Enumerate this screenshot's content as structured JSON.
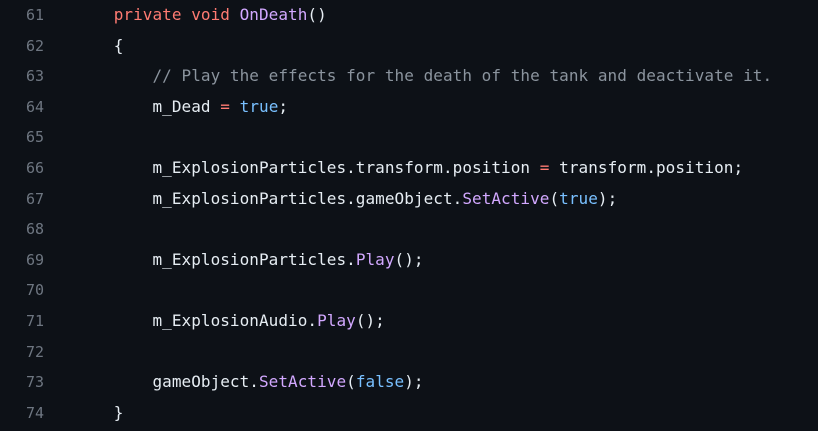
{
  "theme": {
    "background": "#0d1117",
    "line_number_color": "#6e7681",
    "text_color": "#e6edf3",
    "keyword_color": "#ff7b72",
    "function_color": "#d2a8ff",
    "constant_color": "#79c0ff",
    "comment_color": "#8b949e"
  },
  "lines": [
    {
      "number": "61",
      "indent": "    ",
      "tokens": [
        {
          "t": "private",
          "k": "keyword"
        },
        {
          "t": " ",
          "k": "plain"
        },
        {
          "t": "void",
          "k": "keyword"
        },
        {
          "t": " ",
          "k": "plain"
        },
        {
          "t": "OnDeath",
          "k": "func"
        },
        {
          "t": "()",
          "k": "plain"
        }
      ]
    },
    {
      "number": "62",
      "indent": "    ",
      "tokens": [
        {
          "t": "{",
          "k": "plain"
        }
      ]
    },
    {
      "number": "63",
      "indent": "        ",
      "tokens": [
        {
          "t": "// Play the effects for the death of the tank and deactivate it.",
          "k": "comment"
        }
      ]
    },
    {
      "number": "64",
      "indent": "        ",
      "tokens": [
        {
          "t": "m_Dead",
          "k": "plain"
        },
        {
          "t": " ",
          "k": "plain"
        },
        {
          "t": "=",
          "k": "op"
        },
        {
          "t": " ",
          "k": "plain"
        },
        {
          "t": "true",
          "k": "const"
        },
        {
          "t": ";",
          "k": "plain"
        }
      ]
    },
    {
      "number": "65",
      "indent": "",
      "tokens": []
    },
    {
      "number": "66",
      "indent": "        ",
      "tokens": [
        {
          "t": "m_ExplosionParticles.transform.position",
          "k": "plain"
        },
        {
          "t": " ",
          "k": "plain"
        },
        {
          "t": "=",
          "k": "op"
        },
        {
          "t": " ",
          "k": "plain"
        },
        {
          "t": "transform.position;",
          "k": "plain"
        }
      ]
    },
    {
      "number": "67",
      "indent": "        ",
      "tokens": [
        {
          "t": "m_ExplosionParticles.gameObject.",
          "k": "plain"
        },
        {
          "t": "SetActive",
          "k": "func"
        },
        {
          "t": "(",
          "k": "plain"
        },
        {
          "t": "true",
          "k": "const"
        },
        {
          "t": ");",
          "k": "plain"
        }
      ]
    },
    {
      "number": "68",
      "indent": "",
      "tokens": []
    },
    {
      "number": "69",
      "indent": "        ",
      "tokens": [
        {
          "t": "m_ExplosionParticles.",
          "k": "plain"
        },
        {
          "t": "Play",
          "k": "func"
        },
        {
          "t": "();",
          "k": "plain"
        }
      ]
    },
    {
      "number": "70",
      "indent": "",
      "tokens": []
    },
    {
      "number": "71",
      "indent": "        ",
      "tokens": [
        {
          "t": "m_ExplosionAudio.",
          "k": "plain"
        },
        {
          "t": "Play",
          "k": "func"
        },
        {
          "t": "();",
          "k": "plain"
        }
      ]
    },
    {
      "number": "72",
      "indent": "",
      "tokens": []
    },
    {
      "number": "73",
      "indent": "        ",
      "tokens": [
        {
          "t": "gameObject.",
          "k": "plain"
        },
        {
          "t": "SetActive",
          "k": "func"
        },
        {
          "t": "(",
          "k": "plain"
        },
        {
          "t": "false",
          "k": "const"
        },
        {
          "t": ");",
          "k": "plain"
        }
      ]
    },
    {
      "number": "74",
      "indent": "    ",
      "tokens": [
        {
          "t": "}",
          "k": "plain"
        }
      ]
    }
  ]
}
